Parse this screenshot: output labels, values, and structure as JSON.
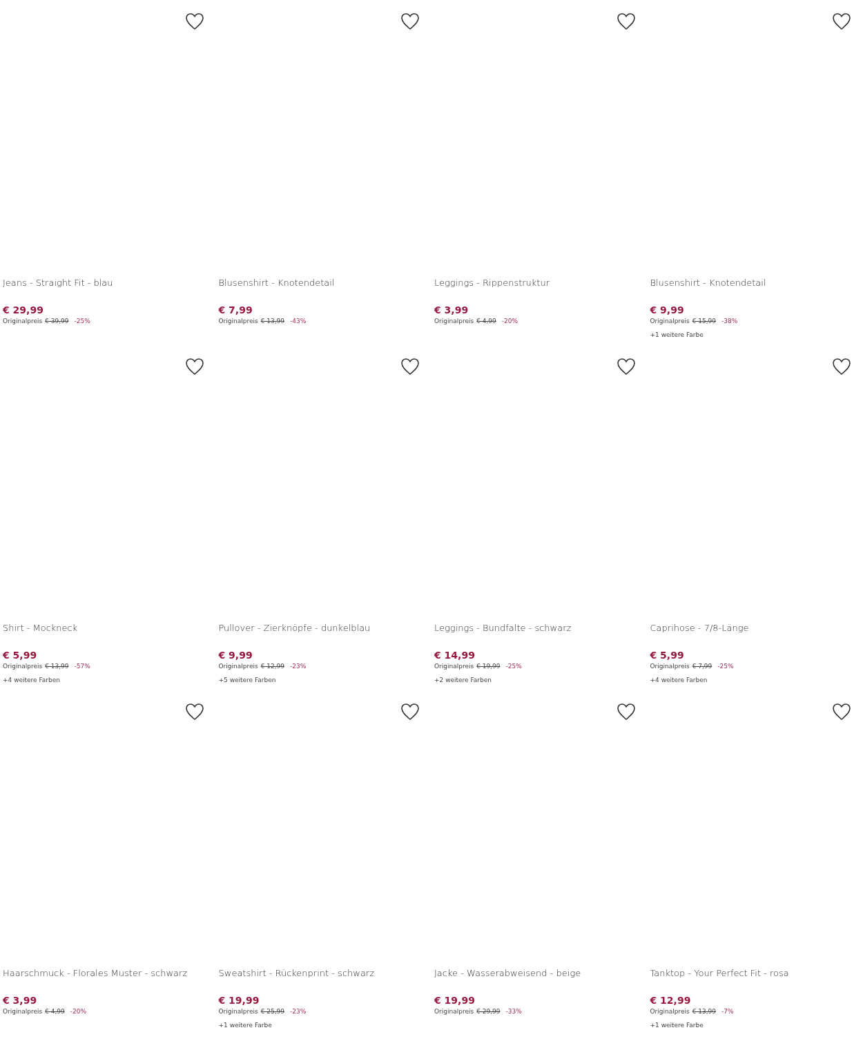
{
  "products": [
    {
      "title": "Jeans - Straight Fit - blau",
      "price": "€ 29,99",
      "original_label": "Originalpreis",
      "original_price": "€ 39,99",
      "discount": "-25%"
    },
    {
      "title": "Blusenshirt - Knotendetail",
      "price": "€ 7,99",
      "original_label": "Originalpreis",
      "original_price": "€ 13,99",
      "discount": "-43%"
    },
    {
      "title": "Leggings - Rippenstruktur",
      "price": "€ 3,99",
      "original_label": "Originalpreis",
      "original_price": "€ 4,99",
      "discount": "-20%"
    },
    {
      "title": "Blusenshirt - Knotendetail",
      "price": "€ 9,99",
      "original_label": "Originalpreis",
      "original_price": "€ 15,99",
      "discount": "-38%",
      "more_colors": "+1 weitere Farbe"
    },
    {
      "title": "Shirt - Mockneck",
      "price": "€ 5,99",
      "original_label": "Originalpreis",
      "original_price": "€ 13,99",
      "discount": "-57%",
      "more_colors": "+4 weitere Farben"
    },
    {
      "title": "Pullover - Zierknöpfe - dunkelblau",
      "price": "€ 9,99",
      "original_label": "Originalpreis",
      "original_price": "€ 12,99",
      "discount": "-23%",
      "more_colors": "+5 weitere Farben"
    },
    {
      "title": "Leggings - Bundfalte - schwarz",
      "price": "€ 14,99",
      "original_label": "Originalpreis",
      "original_price": "€ 19,99",
      "discount": "-25%",
      "more_colors": "+2 weitere Farben"
    },
    {
      "title": "Caprihose - 7/8-Länge",
      "price": "€ 5,99",
      "original_label": "Originalpreis",
      "original_price": "€ 7,99",
      "discount": "-25%",
      "more_colors": "+4 weitere Farben"
    },
    {
      "title": "Haarschmuck - Florales Muster - schwarz",
      "price": "€ 3,99",
      "original_label": "Originalpreis",
      "original_price": "€ 4,99",
      "discount": "-20%"
    },
    {
      "title": "Sweatshirt - Rückenprint - schwarz",
      "price": "€ 19,99",
      "original_label": "Originalpreis",
      "original_price": "€ 25,99",
      "discount": "-23%",
      "more_colors": "+1 weitere Farbe"
    },
    {
      "title": "Jacke - Wasserabweisend - beige",
      "price": "€ 19,99",
      "original_label": "Originalpreis",
      "original_price": "€ 29,99",
      "discount": "-33%"
    },
    {
      "title": "Tanktop - Your Perfect Fit - rosa",
      "price": "€ 12,99",
      "original_label": "Originalpreis",
      "original_price": "€ 13,99",
      "discount": "-7%",
      "more_colors": "+1 weitere Farbe"
    }
  ]
}
